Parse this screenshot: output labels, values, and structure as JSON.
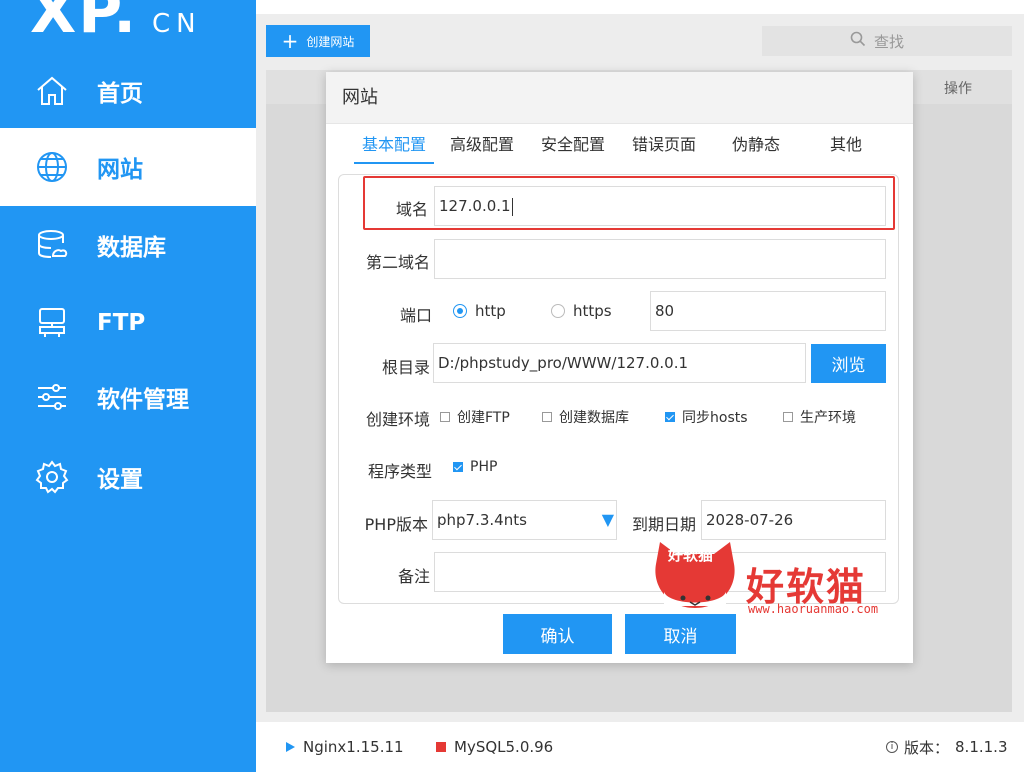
{
  "logo": {
    "main": "XP.",
    "sub": "CN"
  },
  "sidebar": {
    "items": [
      {
        "label": "首页",
        "icon": "home-icon",
        "active": false
      },
      {
        "label": "网站",
        "icon": "globe-icon",
        "active": true
      },
      {
        "label": "数据库",
        "icon": "database-icon",
        "active": false
      },
      {
        "label": "FTP",
        "icon": "server-icon",
        "active": false
      },
      {
        "label": "软件管理",
        "icon": "sliders-icon",
        "active": false
      },
      {
        "label": "设置",
        "icon": "gear-icon",
        "active": false
      }
    ]
  },
  "toolbar": {
    "create_label": "创建网站",
    "search_placeholder": "查找"
  },
  "table": {
    "op_header": "操作"
  },
  "dialog": {
    "title": "网站",
    "tabs": [
      "基本配置",
      "高级配置",
      "安全配置",
      "错误页面",
      "伪静态",
      "其他"
    ],
    "active_tab": "基本配置",
    "form": {
      "domain_label": "域名",
      "domain_value": "127.0.0.1",
      "second_domain_label": "第二域名",
      "second_domain_value": "",
      "port_label": "端口",
      "http_label": "http",
      "https_label": "https",
      "port_value": "80",
      "root_label": "根目录",
      "root_value": "D:/phpstudy_pro/WWW/127.0.0.1",
      "browse_label": "浏览",
      "env_label": "创建环境",
      "env_options": [
        {
          "label": "创建FTP",
          "checked": false
        },
        {
          "label": "创建数据库",
          "checked": false
        },
        {
          "label": "同步hosts",
          "checked": true
        },
        {
          "label": "生产环境",
          "checked": false
        }
      ],
      "program_label": "程序类型",
      "program_value": "PHP",
      "php_version_label": "PHP版本",
      "php_version_value": "php7.3.4nts",
      "expire_label": "到期日期",
      "expire_value": "2028-07-26",
      "note_label": "备注",
      "note_value": ""
    },
    "confirm_label": "确认",
    "cancel_label": "取消"
  },
  "status": {
    "nginx": "Nginx1.15.11",
    "mysql": "MySQL5.0.96",
    "version_label": "版本：",
    "version_value": "8.1.1.3"
  },
  "watermark": {
    "badge": "好软猫",
    "brand": "好软猫",
    "url": "www.haoruanmao.com"
  },
  "colors": {
    "accent": "#2196f3",
    "highlight": "#e53935",
    "nginx_status": "#2196f3",
    "mysql_status": "#e53935"
  }
}
